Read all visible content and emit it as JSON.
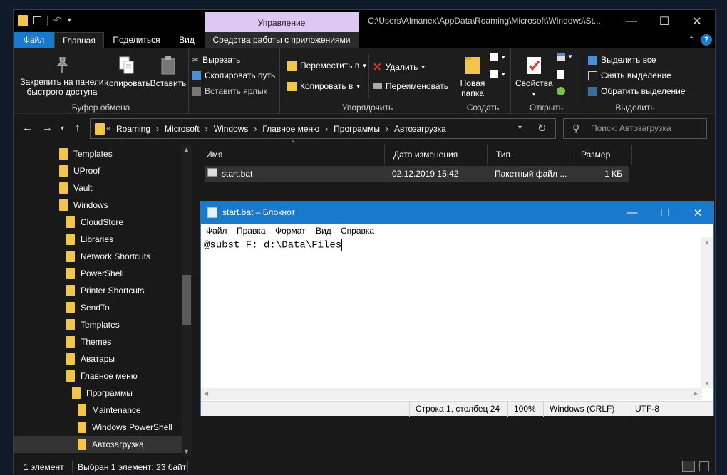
{
  "explorer": {
    "context_tab": "Управление",
    "window_title": "C:\\Users\\Almanex\\AppData\\Roaming\\Microsoft\\Windows\\St...",
    "tabs": [
      "Файл",
      "Главная",
      "Поделиться",
      "Вид",
      "Средства работы с приложениями"
    ],
    "ribbon": {
      "clipboard": {
        "pin": "Закрепить на панели быстрого доступа",
        "pin_l1": "Закрепить на панели",
        "pin_l2": "быстрого доступа",
        "copy": "Копировать",
        "paste": "Вставить",
        "cut": "Вырезать",
        "copy_path": "Скопировать путь",
        "paste_shortcut": "Вставить ярлык",
        "label": "Буфер обмена"
      },
      "organize": {
        "move_to": "Переместить в",
        "copy_to": "Копировать в",
        "delete": "Удалить",
        "rename": "Переименовать",
        "label": "Упорядочить"
      },
      "create": {
        "new_folder_l1": "Новая",
        "new_folder_l2": "папка",
        "label": "Создать"
      },
      "open": {
        "properties": "Свойства",
        "label": "Открыть"
      },
      "select": {
        "select_all": "Выделить все",
        "select_none": "Снять выделение",
        "invert": "Обратить выделение",
        "label": "Выделить"
      }
    },
    "breadcrumb": [
      "Roaming",
      "Microsoft",
      "Windows",
      "Главное меню",
      "Программы",
      "Автозагрузка"
    ],
    "search_placeholder": "Поиск: Автозагрузка",
    "tree": [
      {
        "label": "Templates",
        "indent": 0
      },
      {
        "label": "UProof",
        "indent": 0
      },
      {
        "label": "Vault",
        "indent": 0
      },
      {
        "label": "Windows",
        "indent": 0
      },
      {
        "label": "CloudStore",
        "indent": 1
      },
      {
        "label": "Libraries",
        "indent": 1
      },
      {
        "label": "Network Shortcuts",
        "indent": 1
      },
      {
        "label": "PowerShell",
        "indent": 1
      },
      {
        "label": "Printer Shortcuts",
        "indent": 1
      },
      {
        "label": "SendTo",
        "indent": 1
      },
      {
        "label": "Templates",
        "indent": 1
      },
      {
        "label": "Themes",
        "indent": 1
      },
      {
        "label": "Аватары",
        "indent": 1
      },
      {
        "label": "Главное меню",
        "indent": 1
      },
      {
        "label": "Программы",
        "indent": 2
      },
      {
        "label": "Maintenance",
        "indent": 3
      },
      {
        "label": "Windows PowerShell",
        "indent": 3
      },
      {
        "label": "Автозагрузка",
        "indent": 3,
        "selected": true
      }
    ],
    "columns": [
      "Имя",
      "Дата изменения",
      "Тип",
      "Размер"
    ],
    "files": [
      {
        "name": "start.bat",
        "date": "02.12.2019 15:42",
        "type": "Пакетный файл ...",
        "size": "1 КБ"
      }
    ],
    "status_count": "1 элемент",
    "status_selected": "Выбран 1 элемент: 23 байт"
  },
  "notepad": {
    "title": "start.bat – Блокнот",
    "menu": [
      "Файл",
      "Правка",
      "Формат",
      "Вид",
      "Справка"
    ],
    "content": "@subst F: d:\\Data\\Files",
    "status": {
      "position": "Строка 1, столбец 24",
      "zoom": "100%",
      "line_endings": "Windows (CRLF)",
      "encoding": "UTF-8"
    }
  },
  "colors": {
    "accent": "#1979ca",
    "context_tab": "#ddc7f3",
    "folder": "#f3c64a",
    "dark_bg": "#191919"
  }
}
